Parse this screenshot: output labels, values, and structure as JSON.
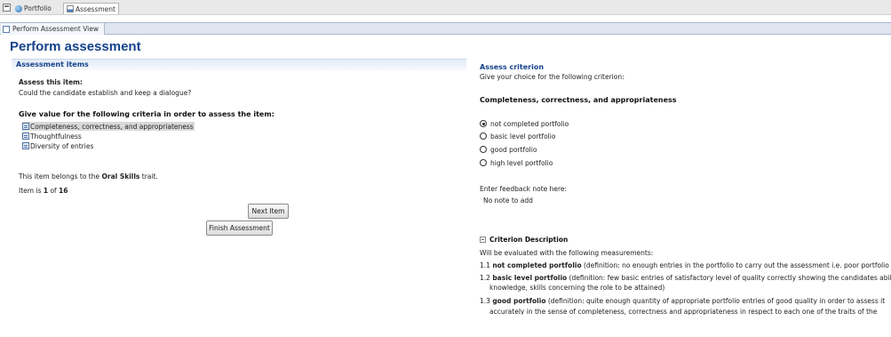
{
  "tabs": [
    {
      "label": "Portfolio",
      "icon": "globe-icon"
    },
    {
      "label": "Assessment",
      "icon": "chart-icon"
    }
  ],
  "view_tab": "Perform Assessment View",
  "page_title": "Perform assessment",
  "left": {
    "section_title": "Assessment items",
    "assess_label": "Assess this item:",
    "question": "Could the candidate establish and keep a dialogue?",
    "criteria_heading": "Give value for the following criteria in order to assess the item:",
    "criteria": [
      "Completeness, correctness, and appropriateness",
      "Thoughtfulness",
      "Diversity of entries"
    ],
    "trait_pre": "This item belongs to the ",
    "trait_name": "Oral Skills",
    "trait_post": " trait.",
    "item_pre": "Item is ",
    "item_current": "1",
    "item_mid": " of ",
    "item_total": "16",
    "next_button": "Next Item",
    "finish_button": "Finish Assessment"
  },
  "right": {
    "title": "Assess criterion",
    "subtitle": "Give your choice for the following criterion:",
    "criterion_name": "Completeness, correctness, and appropriateness",
    "options": [
      {
        "label": "not completed portfolio",
        "checked": true
      },
      {
        "label": "basic level portfolio",
        "checked": false
      },
      {
        "label": "good portfolio",
        "checked": false
      },
      {
        "label": "high level portfolio",
        "checked": false
      }
    ],
    "feedback_label": "Enter feedback note here:",
    "feedback_value": "No note to add",
    "description_title": "Criterion Description",
    "description_intro": "Will be evaluated with the following measurements:",
    "measurements": [
      {
        "num": "1.1 ",
        "name": "not completed portfolio",
        "def": " (definition: no enough entries in the portfolio to carry out the assessment i.e. poor portfolio"
      },
      {
        "num": "1.2 ",
        "name": "basic level portfolio",
        "def": " (definition: few basic entries of satisfactory level of quality correctly showing the candidates abil",
        "def2": "knowledge, skills concerning the role to be attained)"
      },
      {
        "num": "1.3 ",
        "name": "good portfolio",
        "def": " (definition: quite enough quantity of appropriate portfolio entries of good quality in order to assess it",
        "def2": "accurately in the sense of completeness, correctness and appropriateness in respect to each one of the traits of the"
      }
    ]
  }
}
